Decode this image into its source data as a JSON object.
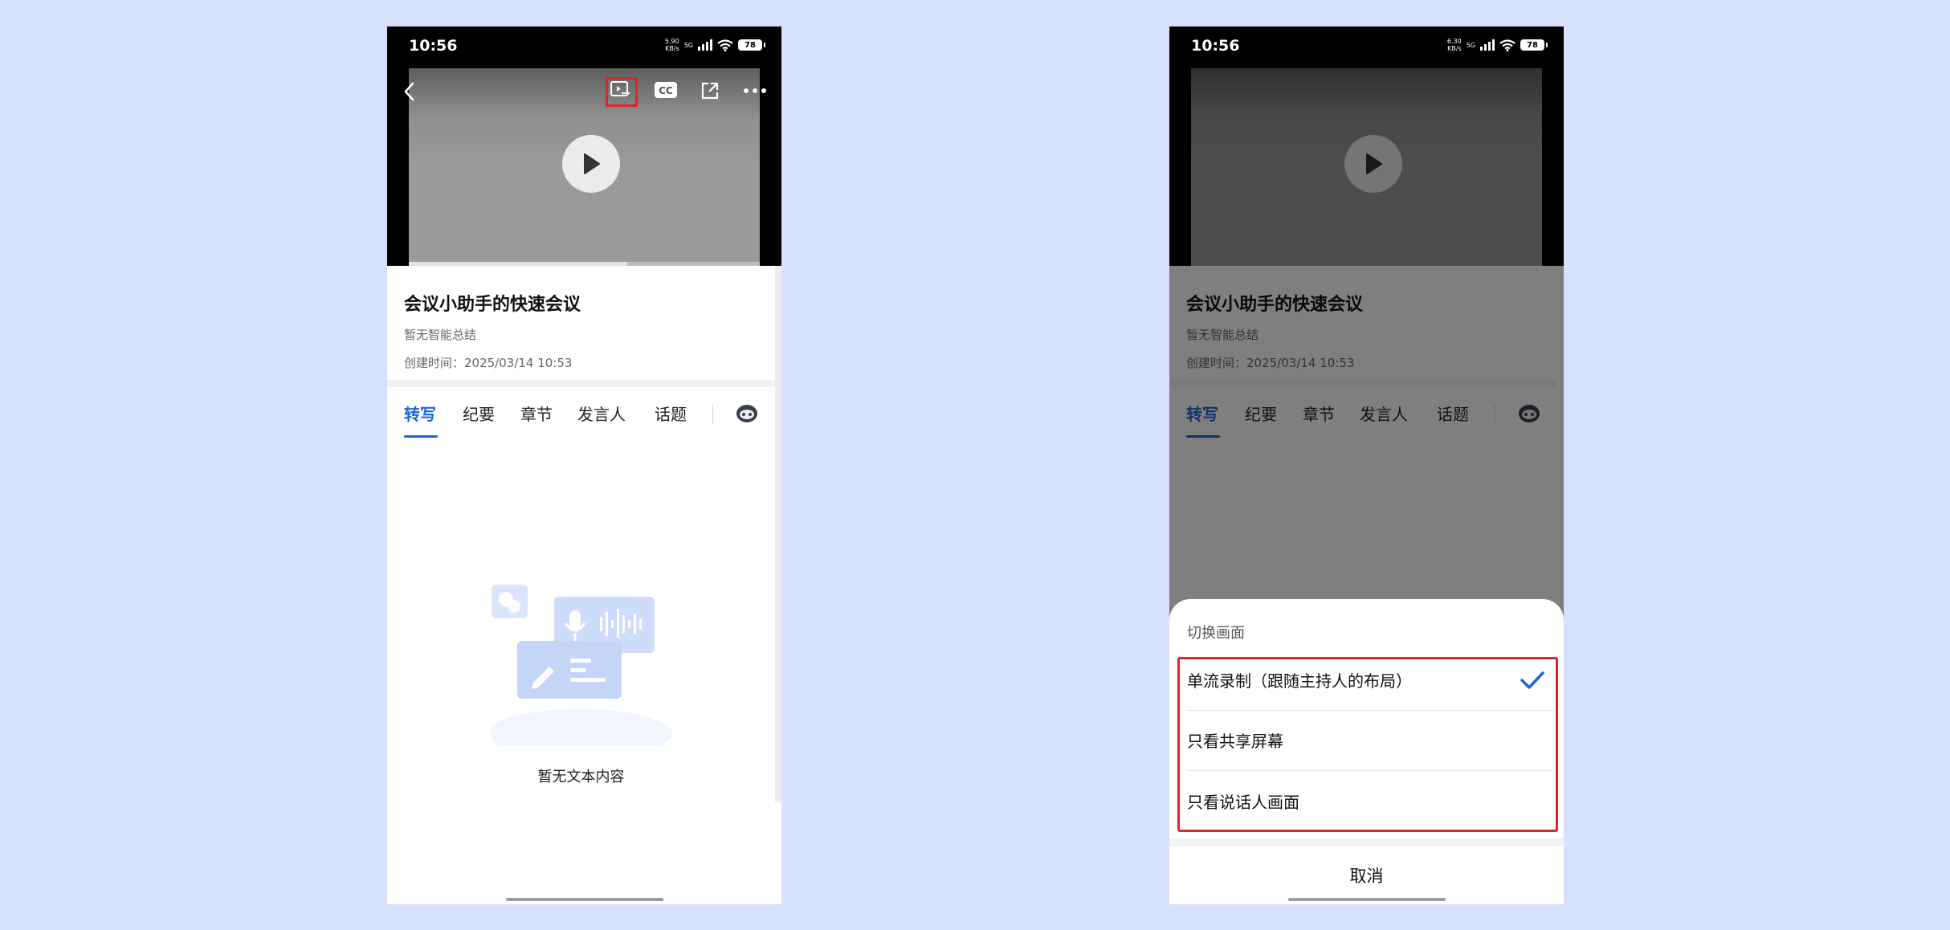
{
  "phones": [
    {
      "status": {
        "time": "10:56",
        "speed_value": "5.90",
        "speed_unit": "KB/s",
        "network": "5G",
        "battery": "78"
      },
      "meeting": {
        "title": "会议小助手的快速会议",
        "summary": "暂无智能总结",
        "created": "创建时间：2025/03/14 10:53"
      },
      "tabs": [
        "转写",
        "纪要",
        "章节",
        "发言人",
        "话题"
      ],
      "empty_text": "暂无文本内容"
    },
    {
      "status": {
        "time": "10:56",
        "speed_value": "6.30",
        "speed_unit": "KB/s",
        "network": "5G",
        "battery": "78"
      },
      "meeting": {
        "title": "会议小助手的快速会议",
        "summary": "暂无智能总结",
        "created": "创建时间：2025/03/14 10:53"
      },
      "tabs": [
        "转写",
        "纪要",
        "章节",
        "发言人",
        "话题"
      ],
      "sheet": {
        "title": "切换画面",
        "options": [
          "单流录制（跟随主持人的布局）",
          "只看共享屏幕",
          "只看说话人画面"
        ],
        "selected_index": 0,
        "cancel": "取消"
      }
    }
  ],
  "colors": {
    "accent": "#1a66d9",
    "highlight": "#e02424",
    "background": "#d6e2fb"
  },
  "icons": [
    "back-icon",
    "switch-view-icon",
    "cc-icon",
    "share-icon",
    "more-icon",
    "play-icon",
    "ai-assistant-icon",
    "check-icon"
  ]
}
